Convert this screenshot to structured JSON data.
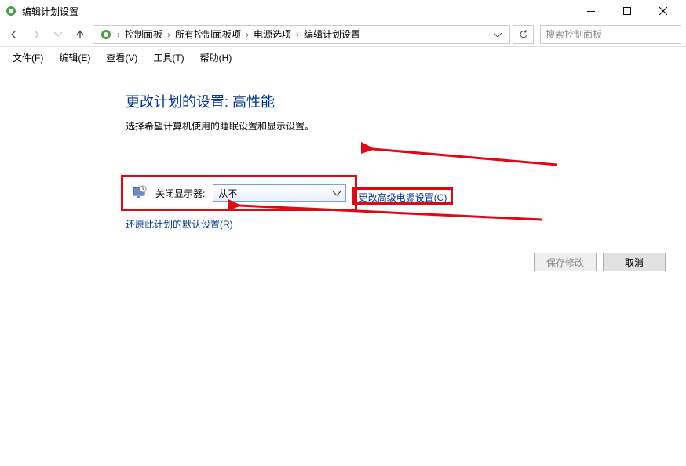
{
  "window": {
    "title": "编辑计划设置"
  },
  "breadcrumb": {
    "items": [
      "控制面板",
      "所有控制面板项",
      "电源选项",
      "编辑计划设置"
    ]
  },
  "search": {
    "placeholder": "搜索控制面板"
  },
  "menu": {
    "file": "文件(F)",
    "edit": "编辑(E)",
    "view": "查看(V)",
    "tools": "工具(T)",
    "help": "帮助(H)"
  },
  "page": {
    "heading": "更改计划的设置: 高性能",
    "subtitle": "选择希望计算机使用的睡眠设置和显示设置。",
    "turnOffDisplayLabel": "关闭显示器:",
    "turnOffDisplayValue": "从不",
    "advancedLink": "更改高级电源设置(C)",
    "restoreLink": "还原此计划的默认设置(R)",
    "saveBtn": "保存修改",
    "cancelBtn": "取消"
  }
}
